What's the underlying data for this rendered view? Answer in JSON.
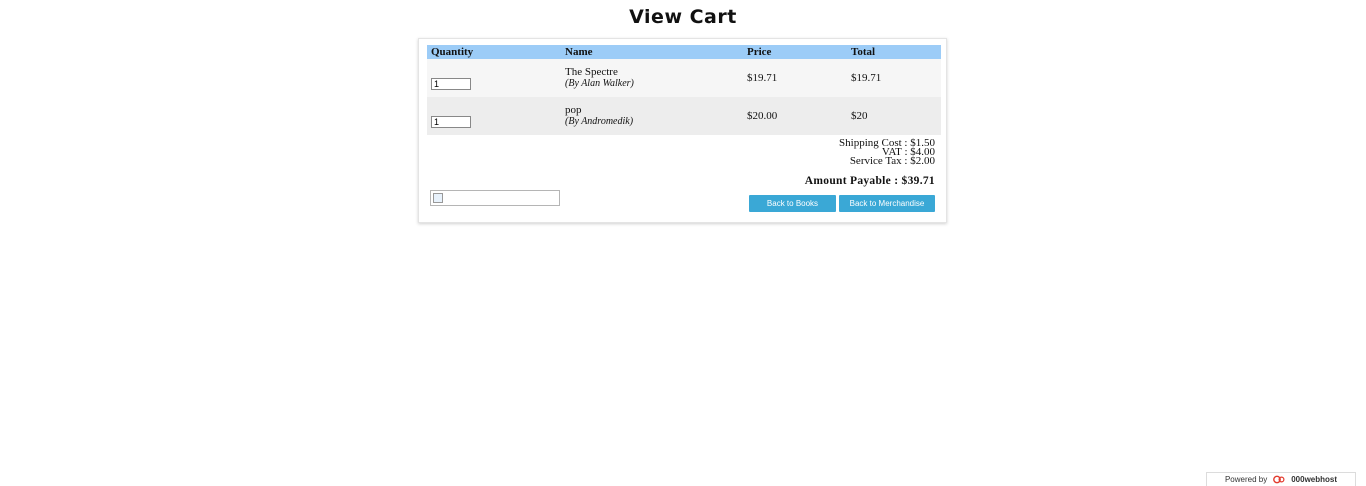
{
  "header": {
    "title": "View Cart"
  },
  "cart": {
    "columns": [
      "Quantity",
      "Name",
      "Price",
      "Total"
    ],
    "items": [
      {
        "quantity": "1",
        "title": "The Spectre",
        "artist": "(By Alan Walker)",
        "price": "$19.71",
        "total": "$19.71"
      },
      {
        "quantity": "1",
        "title": "pop",
        "artist": "(By Andromedik)",
        "price": "$20.00",
        "total": "$20"
      }
    ],
    "summary": {
      "shipping": "Shipping Cost : $1.50",
      "vat": "VAT : $4.00",
      "service_tax": "Service Tax : $2.00",
      "amount_payable": "Amount Payable : $39.71"
    },
    "buttons": {
      "books": "Back to Books",
      "merch": "Back to Merchandise"
    }
  },
  "footer": {
    "powered_label": "Powered by",
    "brand": "000webhost",
    "brand_color": "#e23b2e"
  },
  "colors": {
    "header_row": "#9cccf7",
    "button": "#3aa8d6"
  }
}
